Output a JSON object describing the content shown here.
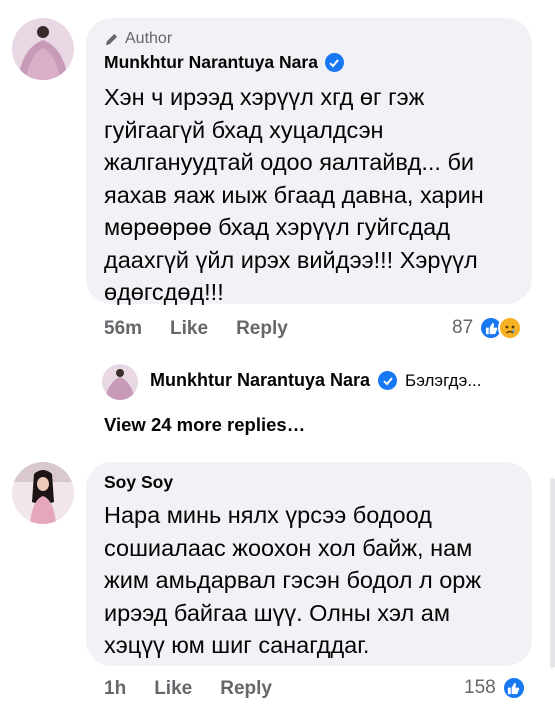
{
  "comment1": {
    "author_badge": "Author",
    "name": "Munkhtur Narantuya Nara",
    "text": "Хэн ч ирээд хэрүүл хгд өг гэж гуйгаагүй бхад хуцалдсэн жалгануудтай одоо яалтайвд... би яахав яаж иыж бгаад давна, харин мөрөөрөө бхад хэрүүл гуйгсдад даахгүй үйл ирэх вийдээ!!! Хэрүүл өдөгсдөд!!!",
    "time": "56m",
    "like_label": "Like",
    "reply_label": "Reply",
    "reaction_count": "87",
    "reaction_icons": [
      "like-icon",
      "sad-icon"
    ]
  },
  "reply_preview": {
    "name": "Munkhtur Narantuya Nara",
    "snippet": "Бэлэгдэ..."
  },
  "view_more": "View 24 more replies…",
  "comment2": {
    "name": "Soy Soy",
    "text": "Нара минь нялх үрсээ бодоод сошиалаас жоохон хол байж, нам жим амьдарвал гэсэн бодол л орж ирээд байгаа шүү. Олны хэл ам хэцүү юм шиг санагддаг.",
    "time": "1h",
    "like_label": "Like",
    "reply_label": "Reply",
    "reaction_count": "158",
    "reaction_icons": [
      "like-icon"
    ]
  },
  "colors": {
    "bubble": "#f0f2f5",
    "accent": "#1877f2",
    "secondary_text": "#65676b"
  }
}
